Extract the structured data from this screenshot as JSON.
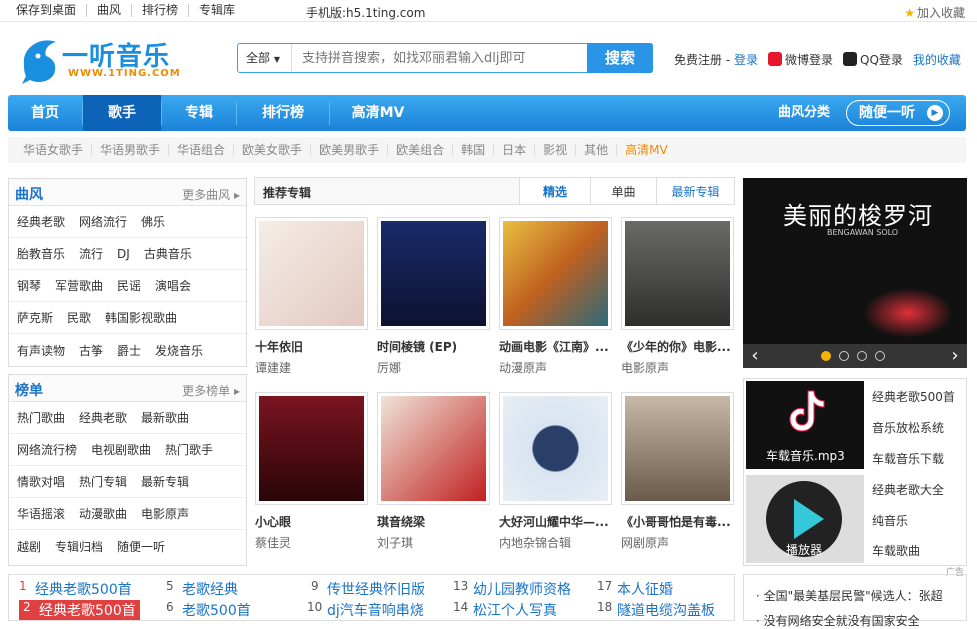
{
  "topbar": {
    "links": [
      "保存到桌面",
      "曲风",
      "排行榜",
      "专辑库"
    ],
    "mobile": "手机版:h5.1ting.com",
    "favorite": "加入收藏"
  },
  "logo": {
    "text": "一听音乐",
    "sub": "WWW.1TING.COM"
  },
  "search": {
    "scope": "全部",
    "placeholder": "支持拼音搜索，如找邓丽君输入dlj即可",
    "button": "搜索"
  },
  "login": {
    "register": "免费注册 - ",
    "login": "登录",
    "weibo": "微博登录",
    "qq": "QQ登录",
    "fav": "我的收藏"
  },
  "nav": {
    "items": [
      "首页",
      "歌手",
      "专辑",
      "排行榜",
      "高清MV"
    ],
    "category": "曲风分类",
    "random": "随便一听"
  },
  "subnav": [
    "华语女歌手",
    "华语男歌手",
    "华语组合",
    "欧美女歌手",
    "欧美男歌手",
    "欧美组合",
    "韩国",
    "日本",
    "影视",
    "其他",
    "高清MV"
  ],
  "genre": {
    "title": "曲风",
    "more": "更多曲风",
    "rows": [
      [
        "经典老歌",
        "网络流行",
        "佛乐"
      ],
      [
        "胎教音乐",
        "流行",
        "DJ",
        "古典音乐"
      ],
      [
        "钢琴",
        "军营歌曲",
        "民谣",
        "演唱会"
      ],
      [
        "萨克斯",
        "民歌",
        "韩国影视歌曲"
      ],
      [
        "有声读物",
        "古筝",
        "爵士",
        "发烧音乐"
      ]
    ]
  },
  "chart": {
    "title": "榜单",
    "more": "更多榜单",
    "rows": [
      [
        "热门歌曲",
        "经典老歌",
        "最新歌曲"
      ],
      [
        "网络流行榜",
        "电视剧歌曲",
        "热门歌手"
      ],
      [
        "情歌对唱",
        "热门专辑",
        "最新专辑"
      ],
      [
        "华语摇滚",
        "动漫歌曲",
        "电影原声"
      ],
      [
        "越剧",
        "专辑归档",
        "随便一听"
      ]
    ]
  },
  "recommend": {
    "title": "推荐专辑",
    "tabs": [
      "精选",
      "单曲",
      "最新专辑"
    ]
  },
  "albums": [
    {
      "name": "十年依旧",
      "artist": "谭建建",
      "color": "#f0e8e0"
    },
    {
      "name": "时间棱镜 (EP)",
      "artist": "厉娜",
      "color": "#1c2450"
    },
    {
      "name": "动画电影《江南》...",
      "artist": "动漫原声",
      "color": "#d8b040"
    },
    {
      "name": "《少年的你》电影...",
      "artist": "电影原声",
      "color": "#4a4a48"
    },
    {
      "name": "小心眼",
      "artist": "蔡佳灵",
      "color": "#5a1018"
    },
    {
      "name": "琪音绕梁",
      "artist": "刘子琪",
      "color": "#e8d8c8"
    },
    {
      "name": "大好河山耀中华—...",
      "artist": "内地杂锦合辑",
      "color": "#c8d8e8"
    },
    {
      "name": "《小哥哥怕是有毒...",
      "artist": "网剧原声",
      "color": "#a89888"
    }
  ],
  "banner": {
    "title": "美丽的梭罗河",
    "subtitle": "BENGAWAN SOLO"
  },
  "ads": {
    "img1": "车载音乐.mp3",
    "img2": "播放器",
    "links": [
      "经典老歌500首",
      "音乐放松系统",
      "车载音乐下载",
      "经典老歌大全",
      "纯音乐",
      "车载歌曲"
    ],
    "tag": "广告"
  },
  "ranks": [
    {
      "n": "1",
      "t": "经典老歌500首"
    },
    {
      "n": "2",
      "t": "经典老歌500首"
    },
    {
      "n": "5",
      "t": "老歌经典"
    },
    {
      "n": "6",
      "t": "老歌500首"
    },
    {
      "n": "9",
      "t": "传世经典怀旧版"
    },
    {
      "n": "10",
      "t": "dj汽车音响串烧"
    },
    {
      "n": "13",
      "t": "幼儿园教师资格"
    },
    {
      "n": "14",
      "t": "松江个人写真"
    },
    {
      "n": "17",
      "t": "本人征婚"
    },
    {
      "n": "18",
      "t": "隧道电缆沟盖板"
    }
  ],
  "news": [
    "全国\"最美基层民警\"候选人：张超",
    "没有网络安全就没有国家安全"
  ]
}
